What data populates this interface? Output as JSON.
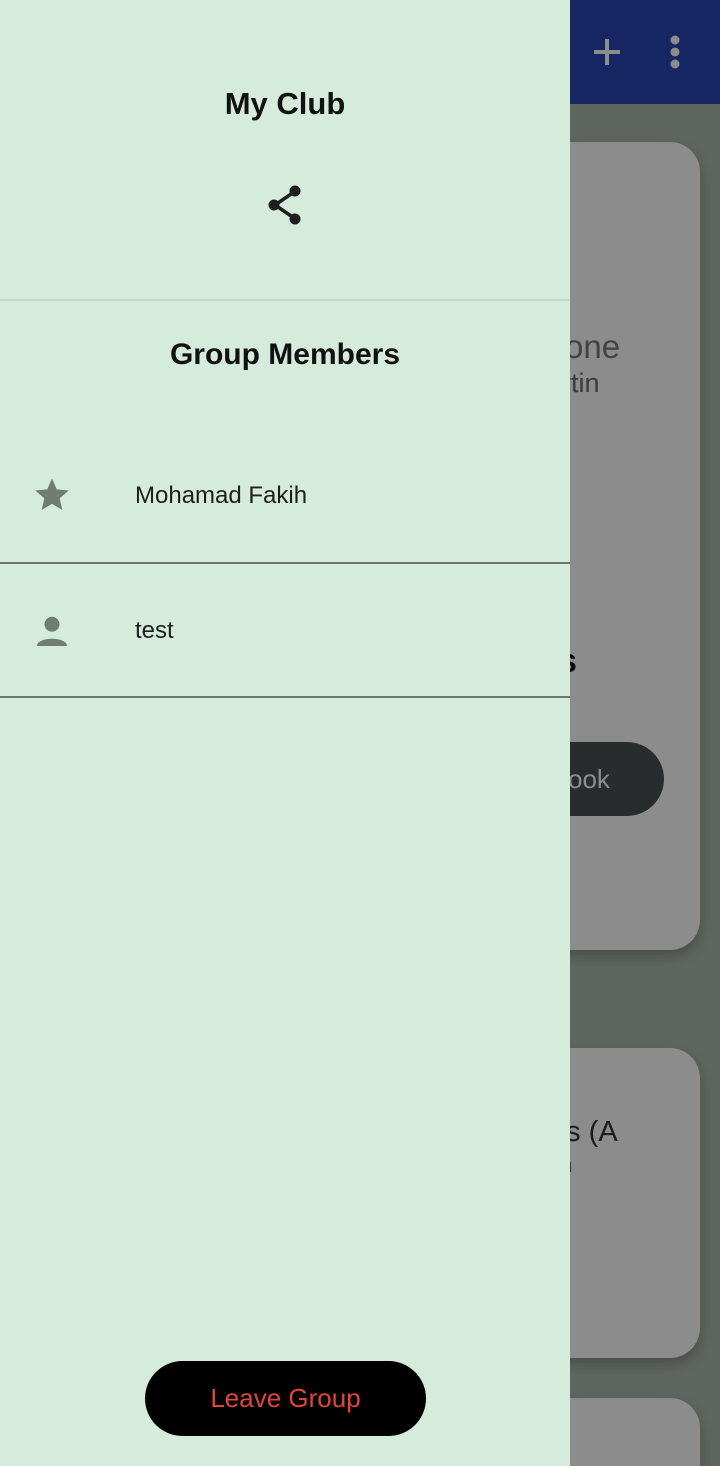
{
  "drawer": {
    "title": "My Club",
    "members_title": "Group Members",
    "members": [
      {
        "name": "Mohamad Fakih",
        "icon": "star-icon"
      },
      {
        "name": "test",
        "icon": "person-icon"
      }
    ],
    "leave_label": "Leave Group"
  },
  "background": {
    "card1_line1": "rone",
    "card1_line2": "rtin",
    "card1_heading_fragment": "s",
    "card1_button": "ook",
    "card2_line1": "es (A",
    "card2_line2": "n"
  },
  "colors": {
    "drawer_bg": "#d5ecdd",
    "appbar": "#2746b5",
    "leave_text": "#e0453b",
    "leave_bg": "#000000"
  }
}
